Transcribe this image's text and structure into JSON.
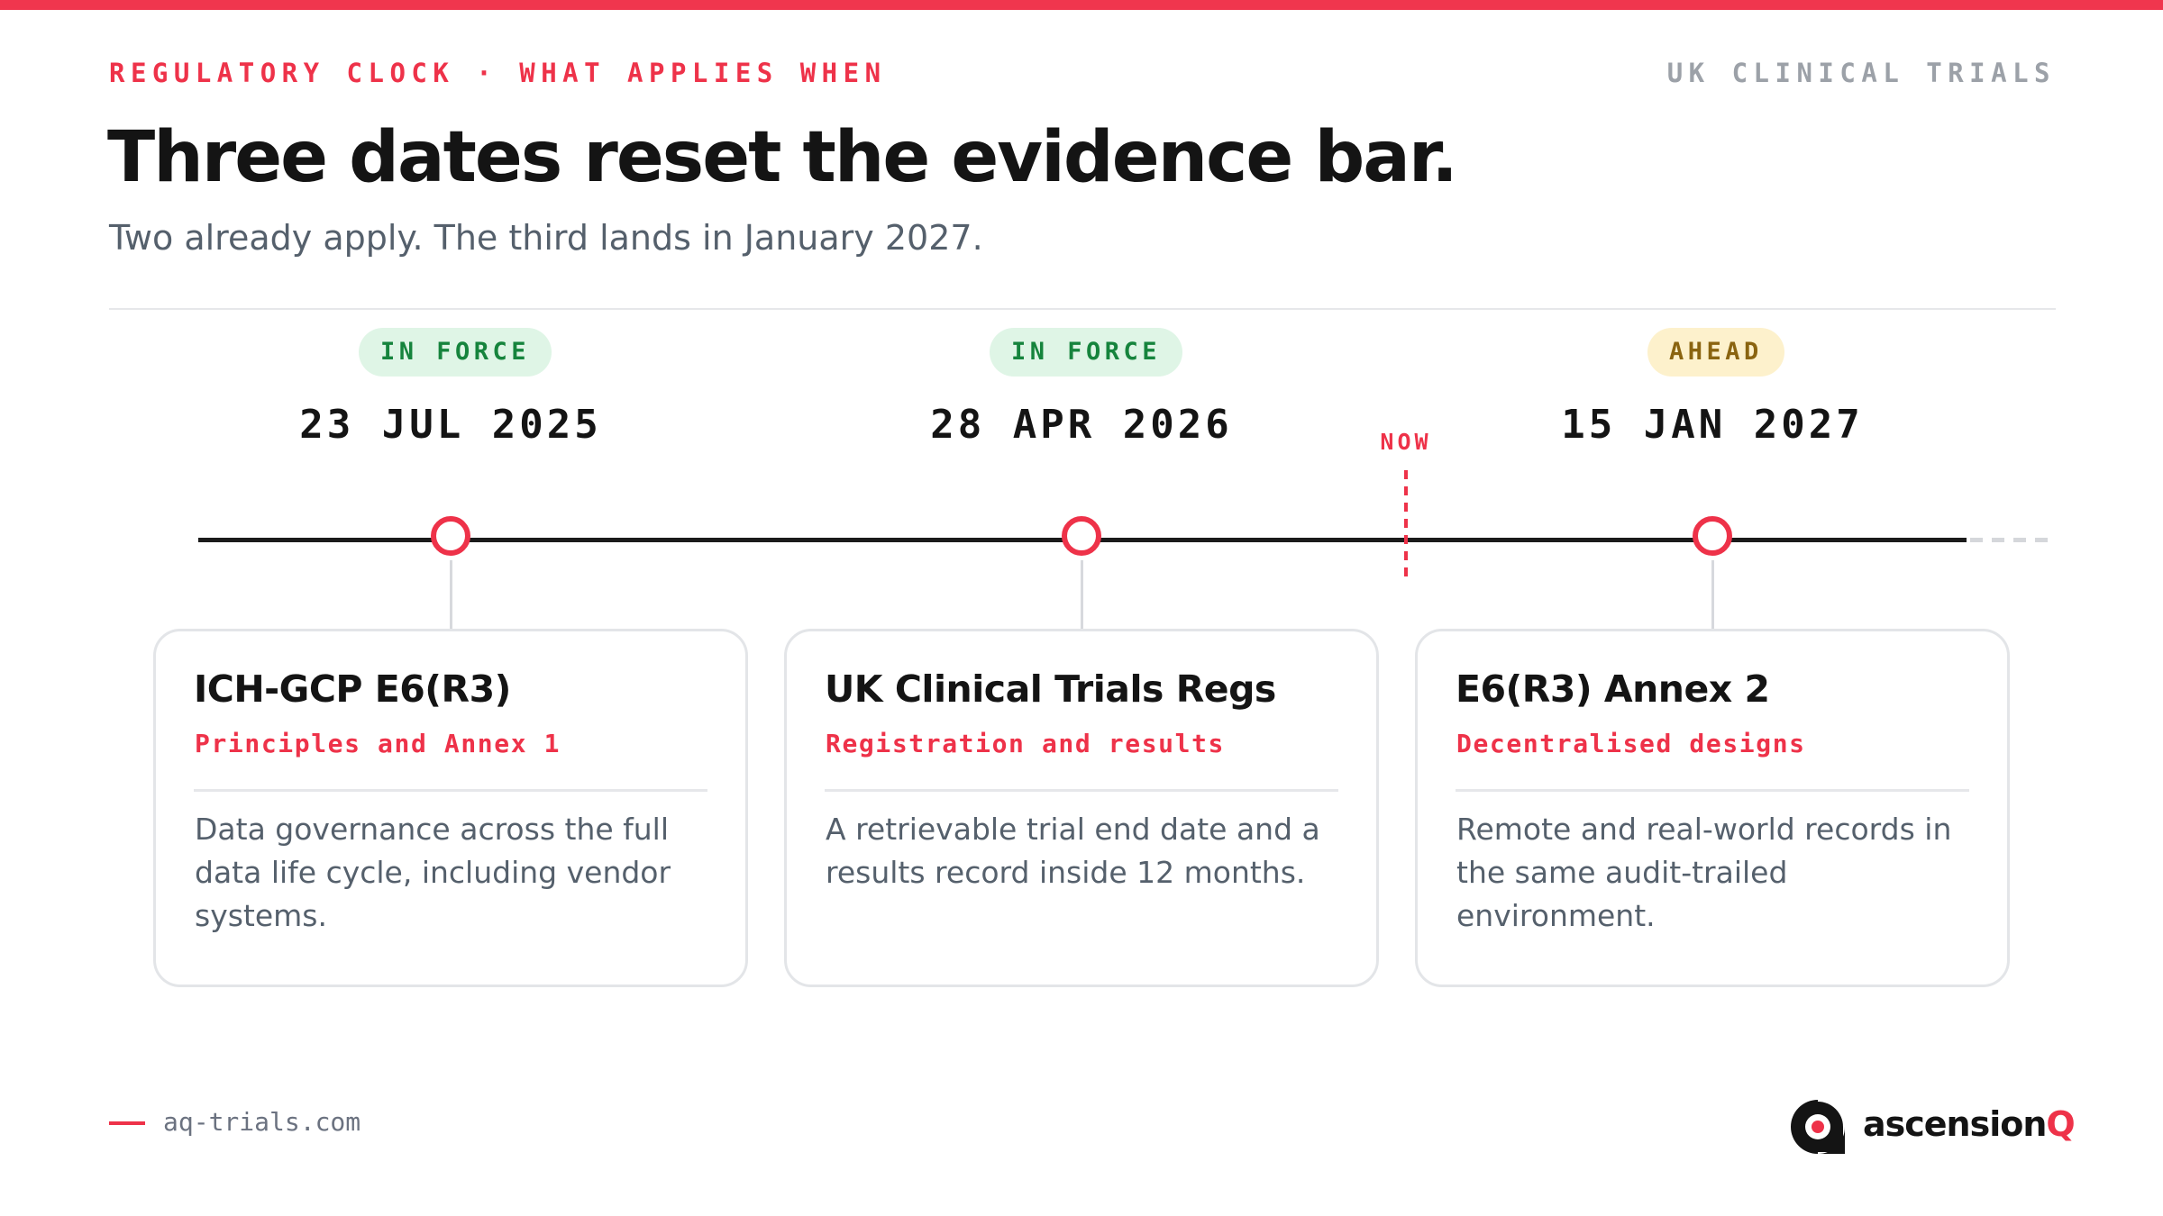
{
  "header": {
    "eyebrow": "REGULATORY CLOCK · WHAT APPLIES WHEN",
    "top_right": "UK CLINICAL TRIALS",
    "title": "Three dates reset the evidence bar.",
    "subtitle": "Two already apply. The third lands in January 2027."
  },
  "timeline": {
    "now_label": "NOW",
    "milestones": [
      {
        "status": "IN FORCE",
        "status_kind": "in-force",
        "date": "23 JUL 2025",
        "card": {
          "title": "ICH-GCP E6(R3)",
          "subtitle": "Principles and Annex 1",
          "body": "Data governance across the full data life cycle, including vendor systems."
        }
      },
      {
        "status": "IN FORCE",
        "status_kind": "in-force",
        "date": "28 APR 2026",
        "card": {
          "title": "UK Clinical Trials Regs",
          "subtitle": "Registration and results",
          "body": "A retrievable trial end date and a results record inside 12 months."
        }
      },
      {
        "status": "AHEAD",
        "status_kind": "ahead",
        "date": "15 JAN 2027",
        "card": {
          "title": "E6(R3) Annex 2",
          "subtitle": "Decentralised designs",
          "body": "Remote and real-world records in the same audit-trailed environment."
        }
      }
    ]
  },
  "footer": {
    "url": "aq-trials.com",
    "logo_main": "ascension",
    "logo_accent": "Q"
  },
  "colors": {
    "accent": "#ee3249",
    "in_force_bg": "#dff5e6",
    "in_force_text": "#16843d",
    "ahead_bg": "#fdf1cc",
    "ahead_text": "#8a6410"
  }
}
